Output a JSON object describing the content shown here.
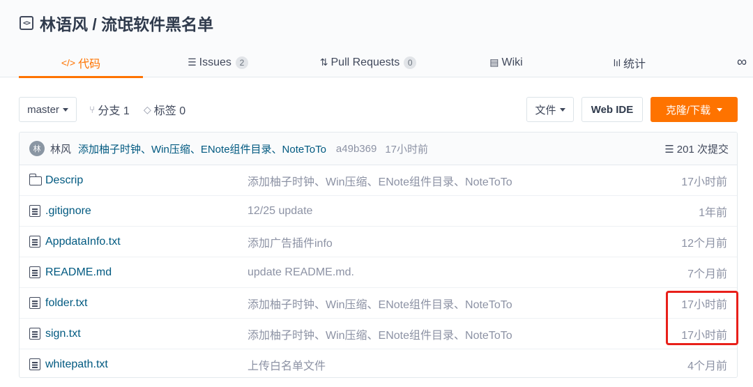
{
  "repo": {
    "icon": "code-repo-icon",
    "title": "林语风 / 流氓软件黑名单"
  },
  "tabs": [
    {
      "label": "代码",
      "icon": "code-icon",
      "glyph": "</>",
      "active": true
    },
    {
      "label": "Issues",
      "icon": "issues-icon",
      "glyph": "☰",
      "count": "2"
    },
    {
      "label": "Pull Requests",
      "icon": "pull-request-icon",
      "glyph": "⇅",
      "count": "0"
    },
    {
      "label": "Wiki",
      "icon": "wiki-icon",
      "glyph": "▤"
    },
    {
      "label": "统计",
      "icon": "stats-icon",
      "glyph": "lıl"
    },
    {
      "label": "",
      "icon": "more-icon",
      "glyph": "∞"
    }
  ],
  "toolbar": {
    "branch": "master",
    "branches_label": "分支 1",
    "tags_label": "标签 0",
    "file_button": "文件",
    "webide_button": "Web IDE",
    "clone_button": "克隆/下载"
  },
  "commit": {
    "avatar_text": "林",
    "author": "林风",
    "message": "添加柚子时钟、Win压缩、ENote组件目录、NoteToTo",
    "hash": "a49b369",
    "time": "17小时前",
    "count_label": "201 次提交"
  },
  "files": [
    {
      "name": "Descrip",
      "type": "folder",
      "message": "添加柚子时钟、Win压缩、ENote组件目录、NoteToTo",
      "time": "17小时前"
    },
    {
      "name": ".gitignore",
      "type": "file",
      "message": "12/25 update",
      "time": "1年前"
    },
    {
      "name": "AppdataInfo.txt",
      "type": "file",
      "message": "添加广告插件info",
      "time": "12个月前"
    },
    {
      "name": "README.md",
      "type": "file",
      "message": "update README.md.",
      "time": "7个月前"
    },
    {
      "name": "folder.txt",
      "type": "file",
      "message": "添加柚子时钟、Win压缩、ENote组件目录、NoteToTo",
      "time": "17小时前"
    },
    {
      "name": "sign.txt",
      "type": "file",
      "message": "添加柚子时钟、Win压缩、ENote组件目录、NoteToTo",
      "time": "17小时前"
    },
    {
      "name": "whitepath.txt",
      "type": "file",
      "message": "上传白名单文件",
      "time": "4个月前"
    }
  ],
  "colors": {
    "accent": "#fe7300",
    "link": "#005980",
    "muted": "#8c92a4",
    "highlight": "#e8201a"
  }
}
